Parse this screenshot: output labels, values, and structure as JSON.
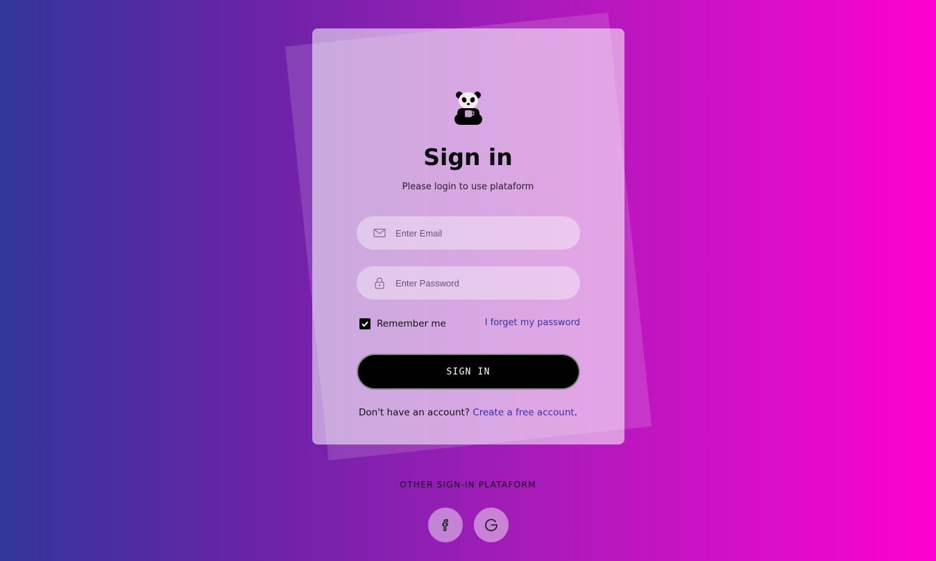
{
  "logo": {
    "icon": "panda-icon"
  },
  "header": {
    "title": "Sign in",
    "subtitle": "Please login to use plataform"
  },
  "form": {
    "email": {
      "placeholder": "Enter Email",
      "value": "",
      "icon": "mail-icon"
    },
    "password": {
      "placeholder": "Enter Password",
      "value": "",
      "icon": "lock-icon"
    },
    "remember": {
      "label": "Remember me",
      "checked": true
    },
    "forgot_label": "I forget my password",
    "submit_label": "SIGN IN"
  },
  "signup": {
    "prompt": "Don't have an account?",
    "link_label": "Create a free account",
    "suffix": "."
  },
  "other": {
    "title": "OTHER SIGN-IN PLATAFORM",
    "platforms": [
      {
        "name": "facebook",
        "icon": "facebook-icon"
      },
      {
        "name": "google",
        "icon": "google-icon"
      }
    ]
  },
  "colors": {
    "gradient_start": "#32369a",
    "gradient_end": "#ff00d0",
    "link": "#3b30a8",
    "button": "#000000"
  }
}
